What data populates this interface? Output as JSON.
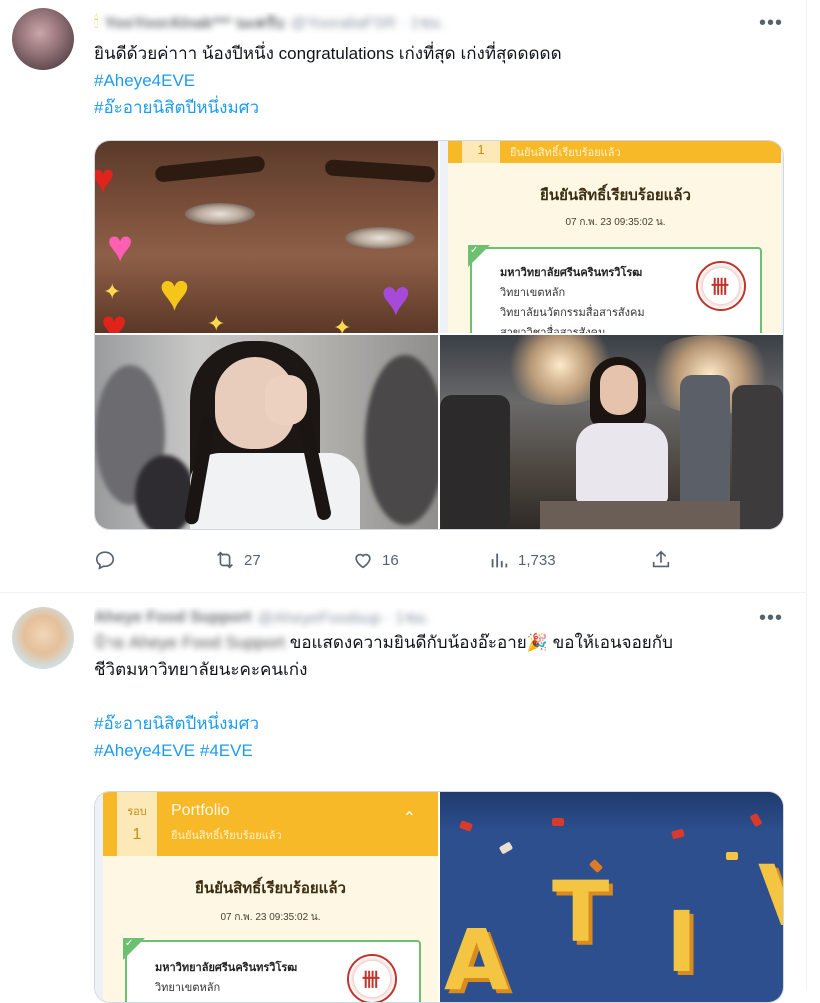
{
  "tweet1": {
    "display_name": "YooYoorAlnak*** นะครับ",
    "handle": "@YooraliaFSR · 1ชม.",
    "text_line": "ยินดีด้วยค่าาา น้องปีหนึ่ง  congratulations เก่งที่สุด เก่งที่สุดดดดด",
    "hashtags": [
      "#Aheye4EVE",
      "#อ๊ะอายนิสิตปีหนึ่งมศว"
    ],
    "card": {
      "round_number": "1",
      "title_small": "ยืนยันสิทธิ์เรียบร้อยแล้ว",
      "heading": "ยืนยันสิทธิ์เรียบร้อยแล้ว",
      "timestamp": "07 ก.พ. 23 09:35:02 น.",
      "university": "มหาวิทยาลัยศรีนครินทรวิโรฒ",
      "campus": "วิทยาเขตหลัก",
      "faculty": "วิทยาลัยนวัตกรรมสื่อสารสังคม",
      "program": "สาขาวิชาสื่อสารสังคม"
    },
    "actions": {
      "reply_count": "",
      "retweet_count": "27",
      "like_count": "16",
      "views_count": "1,733"
    }
  },
  "tweet2": {
    "display_name": "Aheye Food Support",
    "handle": "@AheyeFoodsup · 1ชม.",
    "text_prefix_blurred": "ป้าย Aheye Food Support",
    "text_line1": " ขอแสดงความยินดีกับน้องอ๊ะอาย",
    "party_emoji": "🎉",
    "text_line1_end": " ขอให้เอนจอยกับ",
    "text_line2": "ชีวิตมหาวิทยาลัยนะคะคนเก่ง",
    "hashtag_line1": "#อ๊ะอายนิสิตปีหนึ่งมศว",
    "hashtag_line2a": "#Aheye4EVE",
    "hashtag_line2b": "#4EVE",
    "card": {
      "round_label": "รอบ",
      "round_number": "1",
      "title": "Portfolio",
      "subtitle": "ยืนยันสิทธิ์เรียบร้อยแล้ว",
      "heading": "ยืนยันสิทธิ์เรียบร้อยแล้ว",
      "timestamp": "07 ก.พ. 23 09:35:02 น.",
      "university": "มหาวิทยาลัยศรีนครินทรวิโรฒ",
      "campus": "วิทยาเขตหลัก"
    },
    "banner_letters": [
      "A",
      "T",
      "I",
      "V"
    ]
  },
  "ui": {
    "more_label": "•••",
    "accent_color": "#1d9bf0",
    "muted_color": "#536471"
  }
}
